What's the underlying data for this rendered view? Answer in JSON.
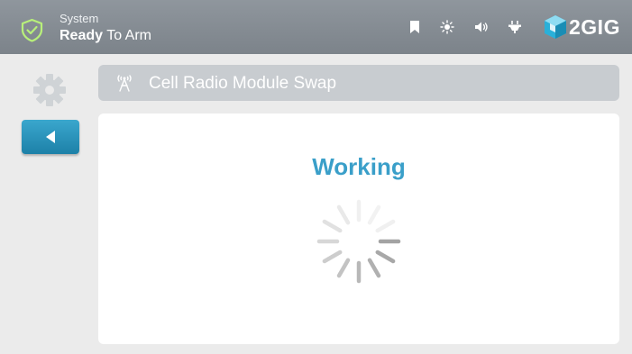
{
  "status": {
    "line1": "System",
    "line2_bold": "Ready",
    "line2_rest": " To Arm",
    "icons": [
      "shield-check-icon",
      "bookmark-icon",
      "brightness-icon",
      "volume-icon",
      "power-plug-icon"
    ]
  },
  "brand": {
    "name": "2GIG",
    "logo_icon": "cube-logo-icon"
  },
  "sidebar": {
    "settings_icon": "gear-icon",
    "back_icon": "back-arrow-icon"
  },
  "header": {
    "title": "Cell Radio Module Swap",
    "icon": "cell-tower-icon"
  },
  "main": {
    "status_text": "Working",
    "spinner_icon": "loading-spinner-icon"
  },
  "colors": {
    "status_bar": "#868d94",
    "accent_blue": "#3a9fc9",
    "back_button": "#2a90b8",
    "title_bar": "#c8ccd0",
    "background": "#ebebeb"
  }
}
